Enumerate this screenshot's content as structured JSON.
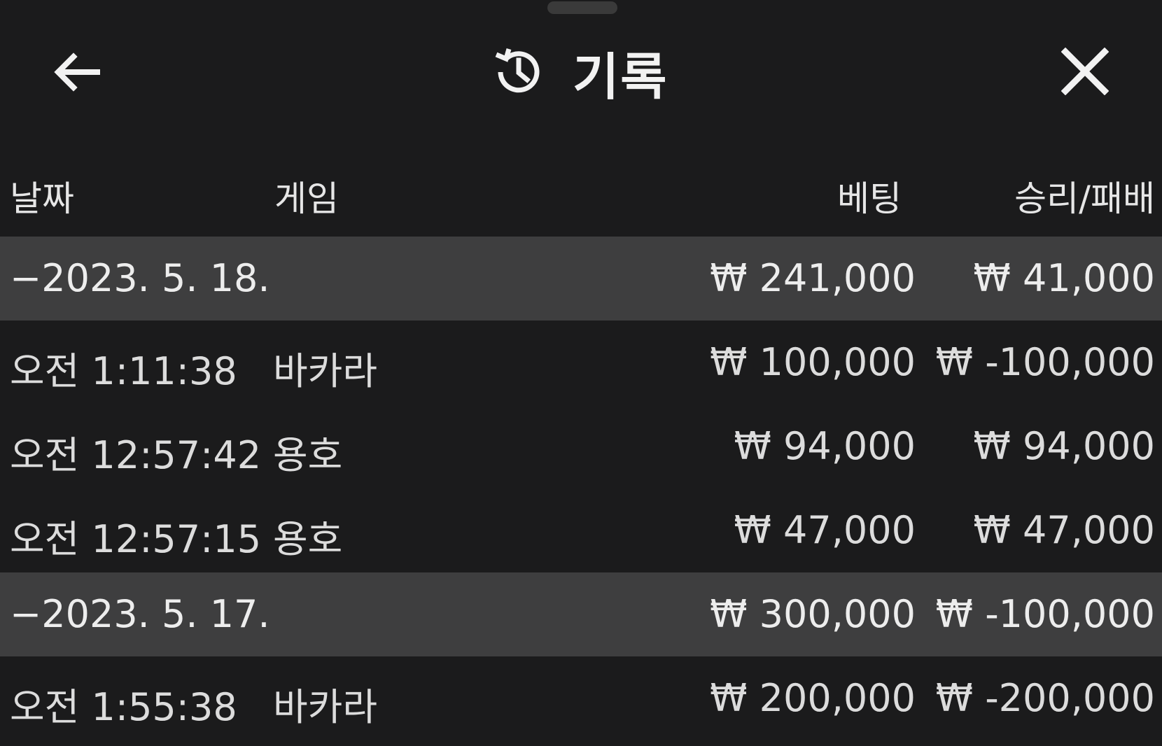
{
  "header": {
    "title": "기록",
    "back_icon": "arrow-left-icon",
    "history_icon": "history-icon",
    "close_icon": "close-icon"
  },
  "columns": {
    "date": "날짜",
    "game": "게임",
    "bet": "베팅",
    "win_loss": "승리/패배"
  },
  "groups": [
    {
      "date": "−2023. 5. 18.",
      "bet_total": "₩ 241,000",
      "win_total": "₩ 41,000",
      "rows": [
        {
          "time": "오전 1:11:38",
          "game": "바카라",
          "bet": "₩ 100,000",
          "win": "₩ -100,000"
        },
        {
          "time": "오전 12:57:42",
          "game": "용호",
          "bet": "₩ 94,000",
          "win": "₩ 94,000"
        },
        {
          "time": "오전 12:57:15",
          "game": "용호",
          "bet": "₩ 47,000",
          "win": "₩ 47,000"
        }
      ]
    },
    {
      "date": "−2023. 5. 17.",
      "bet_total": "₩ 300,000",
      "win_total": "₩ -100,000",
      "rows": [
        {
          "time": "오전 1:55:38",
          "game": "바카라",
          "bet": "₩ 200,000",
          "win": "₩ -200,000"
        }
      ]
    }
  ]
}
